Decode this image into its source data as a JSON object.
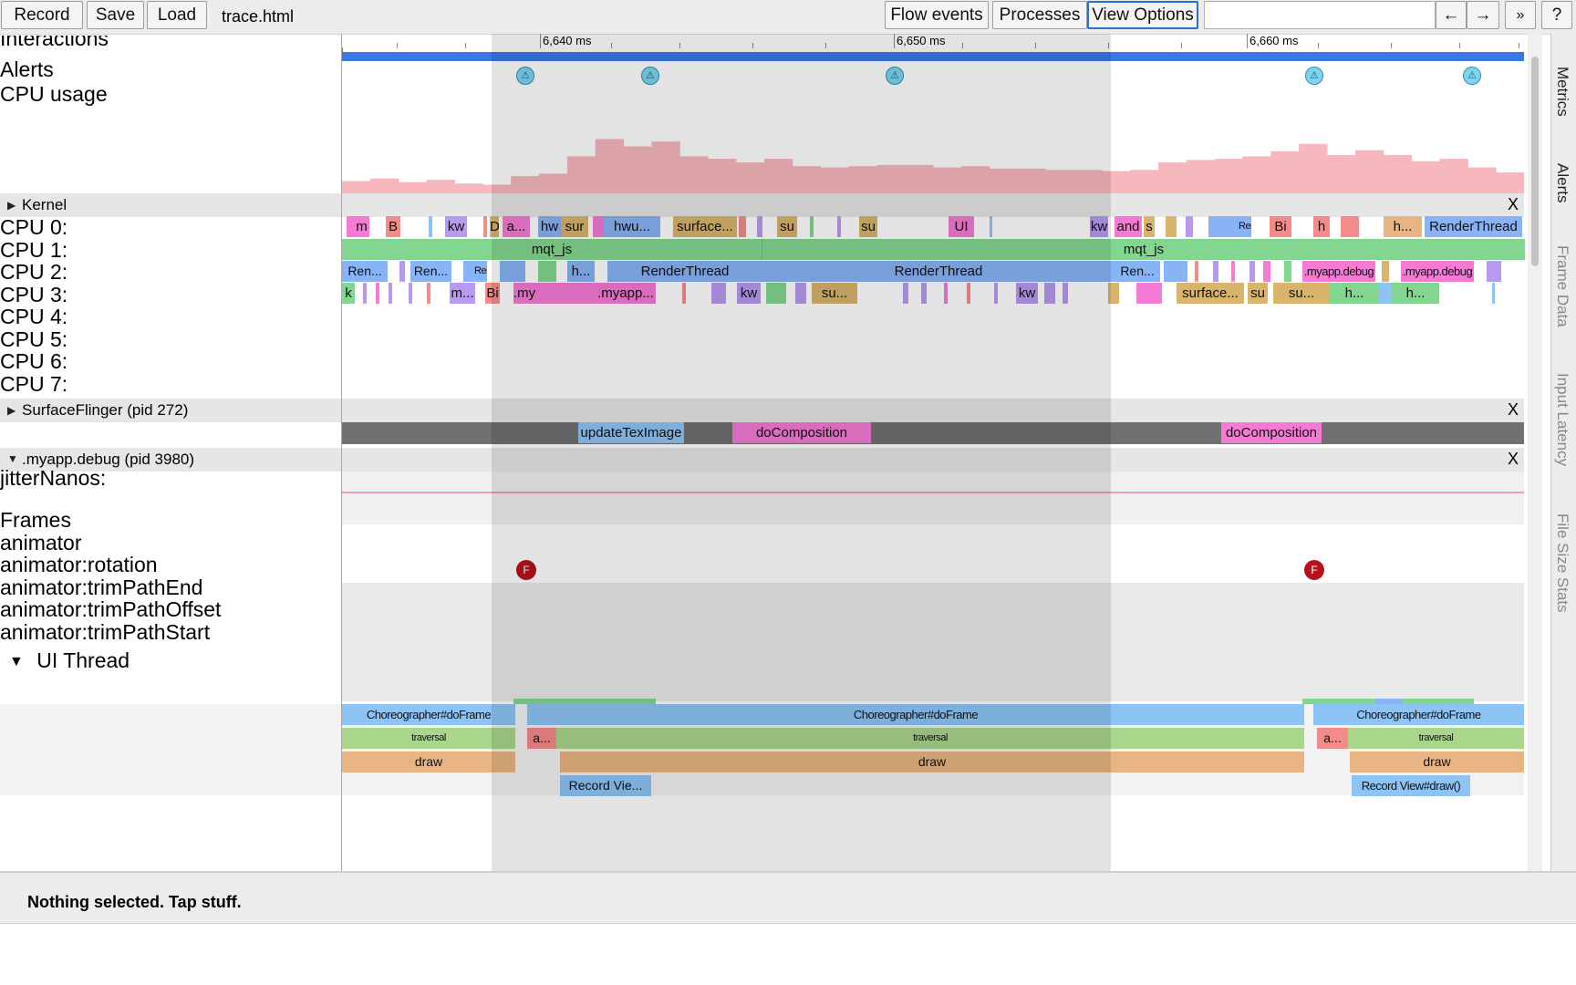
{
  "toolbar": {
    "record": "Record",
    "save": "Save",
    "load": "Load",
    "filename": "trace.html",
    "flow_events": "Flow events",
    "processes": "Processes",
    "view_options": "View Options",
    "back": "←",
    "forward": "→",
    "more": "»",
    "help": "?"
  },
  "ruler": {
    "ticks": [
      "6,640 ms",
      "6,650 ms",
      "6,660 ms"
    ]
  },
  "tracks": {
    "interactions": "Interactions",
    "alerts": "Alerts",
    "cpu_usage": "CPU usage",
    "cpus": [
      "CPU 0:",
      "CPU 1:",
      "CPU 2:",
      "CPU 3:",
      "CPU 4:",
      "CPU 5:",
      "CPU 6:",
      "CPU 7:"
    ],
    "jitter": "jitterNanos:",
    "frames": "Frames",
    "animators": [
      "animator",
      "animator:rotation",
      "animator:trimPathEnd",
      "animator:trimPathOffset",
      "animator:trimPathStart"
    ],
    "ui_thread": "UI Thread"
  },
  "groups": {
    "kernel": "Kernel",
    "surfaceflinger": "SurfaceFlinger (pid 272)",
    "myapp": ".myapp.debug (pid 3980)",
    "close": "X"
  },
  "cpu0_slices": [
    "m",
    "B",
    "kw",
    "D",
    "a...",
    "hw",
    "sur",
    "hwu...",
    "surface...",
    "su",
    "su",
    "UI",
    "kw",
    "and",
    "s",
    "Ren",
    "Bi",
    "h",
    "h...",
    "RenderThread"
  ],
  "cpu1_slices": [
    "mqt_js",
    "mqt_js"
  ],
  "cpu2_slices": [
    "Ren...",
    "Ren...",
    "Ren",
    "h...",
    "RenderThread",
    "RenderThread",
    "Ren...",
    ".myapp.debug",
    ".myapp.debug"
  ],
  "cpu3_slices": [
    "k",
    "m...",
    "Bi",
    ".my",
    ".myapp...",
    "kw",
    "su...",
    "kw",
    "surface...",
    "su",
    "su...",
    "h...",
    "h..."
  ],
  "sf_slices": [
    "updateTexImage",
    "doComposition",
    "doComposition"
  ],
  "ui_slices": {
    "doframe": [
      "Choreographer#doFrame",
      "Choreographer#doFrame",
      "Choreographer#doFrame"
    ],
    "traversal": [
      "traversal",
      "traversal",
      "traversal"
    ],
    "anim": [
      "a...",
      "a..."
    ],
    "draw": [
      "draw",
      "draw",
      "draw"
    ],
    "record": [
      "Record Vie...",
      "Record View#draw()"
    ]
  },
  "alert_icon": "warning-triangle-icon",
  "frame_marker": "F",
  "cpu_usage_series": [
    10,
    12,
    9,
    11,
    8,
    7,
    14,
    16,
    30,
    44,
    38,
    42,
    30,
    28,
    25,
    28,
    22,
    21,
    22,
    23,
    23,
    21,
    22,
    20,
    20,
    19,
    19,
    18,
    19,
    25,
    27,
    28,
    30,
    34,
    40,
    31,
    35,
    31,
    26,
    28,
    21,
    17
  ],
  "side_tabs": [
    "Metrics",
    "Alerts",
    "Frame Data",
    "Input Latency",
    "File Size Stats"
  ],
  "analysis": {
    "text": "Nothing selected. Tap stuff."
  },
  "colors": {
    "pink": "#f47ad4",
    "purple": "#b89af0",
    "blue": "#88b3f5",
    "green": "#83d68f",
    "tan": "#d8b46c",
    "salmon": "#f48b8b",
    "lightblue": "#8ec4f5",
    "orange": "#e8b483"
  }
}
